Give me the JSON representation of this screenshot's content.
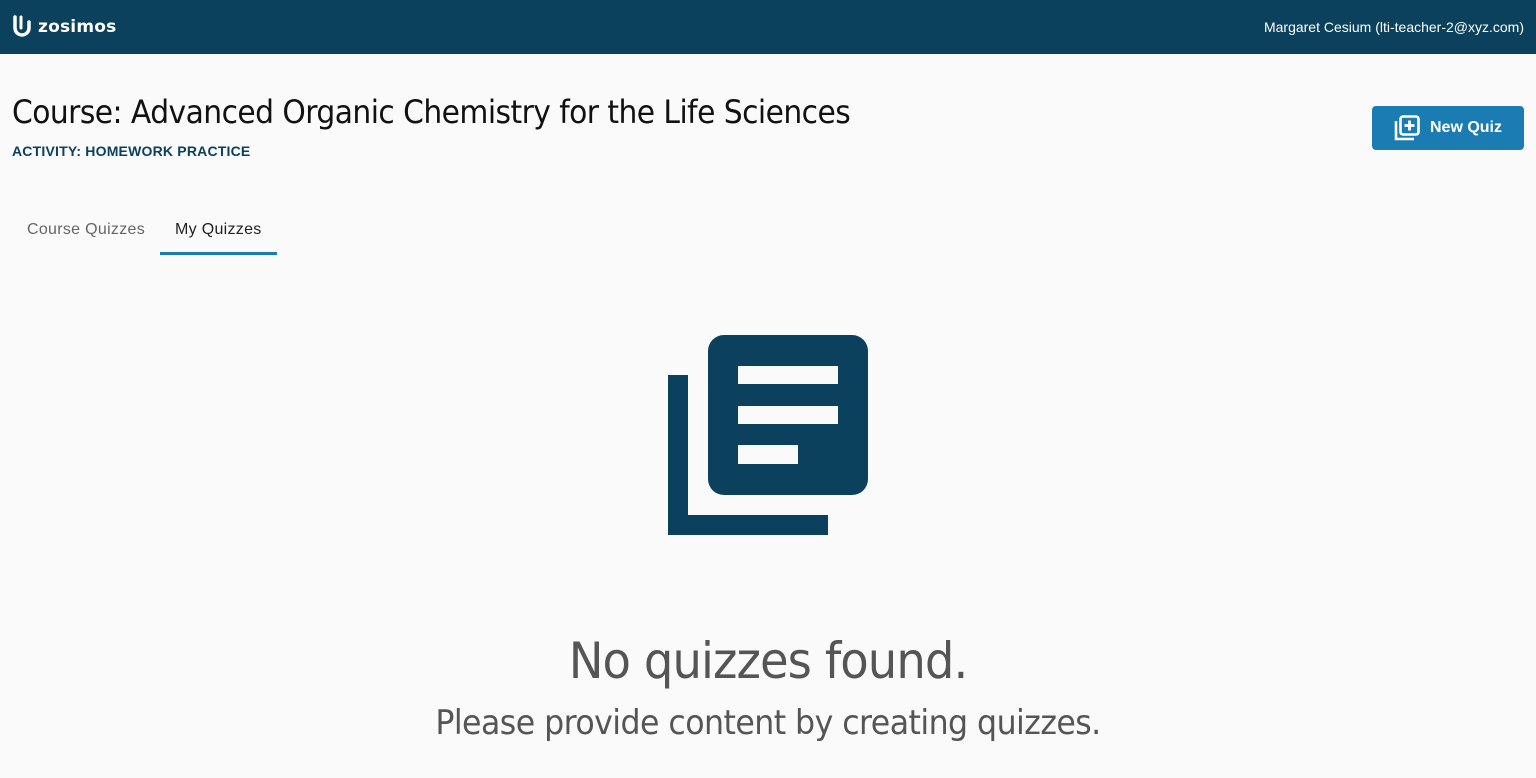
{
  "header": {
    "logo_text": "zosimos",
    "logo_icon": "zosimos-logo-icon",
    "user": "Margaret Cesium (lti-teacher-2@xyz.com)",
    "background_color": "#0b415c"
  },
  "page": {
    "course_title": "Course: Advanced Organic Chemistry for the Life Sciences",
    "activity_label": "ACTIVITY: HOMEWORK PRACTICE"
  },
  "toolbar": {
    "new_quiz_label": "New Quiz",
    "new_quiz_icon": "library-add-icon",
    "accent_color": "#1b7cb3"
  },
  "tabs": [
    {
      "label": "Course Quizzes",
      "active": false
    },
    {
      "label": "My Quizzes",
      "active": true
    }
  ],
  "empty_state": {
    "icon": "library-books-icon",
    "title": "No quizzes found.",
    "subtitle": "Please provide content by creating quizzes."
  }
}
